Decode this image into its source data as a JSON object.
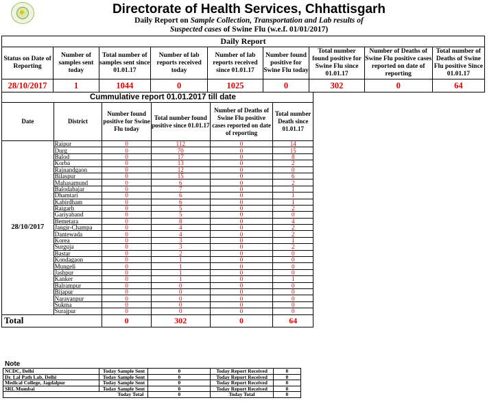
{
  "header": {
    "title": "Directorate of Health Services, Chhattisgarh",
    "line2_prefix": "Daily Report on ",
    "line2_italic": "Sample Collection, Transportation and Lab results of",
    "line3_italic": "Suspected cases",
    "line3_suffix": " of Swine Flu (w.e.f.  01/01/2017)"
  },
  "daily_report": {
    "caption": "Daily Report",
    "columns": [
      "Status on Date of Reporting",
      "Number of samples sent today",
      "Total number of samples sent since 01.01.17",
      "Number of lab reports received today",
      "Number of lab reports received since 01.01.17",
      "Number found positive for Swine Flu today",
      "Total number found positive for Swine Flu since 01.01.17",
      "Number of Deaths of Swine Flu positive cases reported on date of reporting",
      "Total number of Deaths of Swine Flu positive Since 01.01.17"
    ],
    "values": [
      "28/10/2017",
      "1",
      "1044",
      "0",
      "1025",
      "0",
      "302",
      "0",
      "64"
    ]
  },
  "cumulative": {
    "caption": "Cummulative report 01.01.2017 till date",
    "columns": [
      "Date",
      "District",
      "Number found positive for Swine Flu today",
      "Total number found positive since 01.01.17",
      "Number of Deaths of Swine Flu positive cases reported on date of reporting",
      "Total number Death since 01.01.17"
    ],
    "date": "28/10/2017",
    "rows": [
      {
        "district": "Raipur",
        "today": "0",
        "total": "112",
        "deaths_today": "0",
        "deaths_total": "14"
      },
      {
        "district": "Durg",
        "today": "0",
        "total": "70",
        "deaths_today": "0",
        "deaths_total": "15"
      },
      {
        "district": "Balod",
        "today": "0",
        "total": "17",
        "deaths_today": "0",
        "deaths_total": "8"
      },
      {
        "district": "Korba",
        "today": "0",
        "total": "13",
        "deaths_today": "0",
        "deaths_total": "2"
      },
      {
        "district": "Rajnandgaon",
        "today": "0",
        "total": "12",
        "deaths_today": "0",
        "deaths_total": "0"
      },
      {
        "district": "Bilaspur",
        "today": "0",
        "total": "15",
        "deaths_today": "0",
        "deaths_total": "6"
      },
      {
        "district": "Mahasamund",
        "today": "0",
        "total": "6",
        "deaths_today": "0",
        "deaths_total": "2"
      },
      {
        "district": "Balodabajar",
        "today": "0",
        "total": "7",
        "deaths_today": "0",
        "deaths_total": "1"
      },
      {
        "district": "Dhamtari",
        "today": "0",
        "total": "6",
        "deaths_today": "0",
        "deaths_total": "1"
      },
      {
        "district": "Kabirdham",
        "today": "0",
        "total": "6",
        "deaths_today": "0",
        "deaths_total": "1"
      },
      {
        "district": "Raigarh",
        "today": "0",
        "total": "5",
        "deaths_today": "0",
        "deaths_total": "2"
      },
      {
        "district": "Gariyaband",
        "today": "0",
        "total": "5",
        "deaths_today": "0",
        "deaths_total": "0"
      },
      {
        "district": "Bemetara",
        "today": "0",
        "total": "8",
        "deaths_today": "0",
        "deaths_total": "4"
      },
      {
        "district": "Jangir-Champa",
        "today": "0",
        "total": "4",
        "deaths_today": "0",
        "deaths_total": "2"
      },
      {
        "district": "Dantewada",
        "today": "0",
        "total": "4",
        "deaths_today": "0",
        "deaths_total": "2"
      },
      {
        "district": "Korea",
        "today": "0",
        "total": "3",
        "deaths_today": "0",
        "deaths_total": "1"
      },
      {
        "district": "Surguja",
        "today": "0",
        "total": "3",
        "deaths_today": "0",
        "deaths_total": "2"
      },
      {
        "district": "Bastar",
        "today": "0",
        "total": "2",
        "deaths_today": "0",
        "deaths_total": "0"
      },
      {
        "district": "Kondagaon",
        "today": "0",
        "total": "1",
        "deaths_today": "0",
        "deaths_total": "0"
      },
      {
        "district": "Mungeli",
        "today": "0",
        "total": "1",
        "deaths_today": "0",
        "deaths_total": "0"
      },
      {
        "district": "Jashpur",
        "today": "0",
        "total": "1",
        "deaths_today": "0",
        "deaths_total": "0"
      },
      {
        "district": "Kanker",
        "today": "0",
        "total": "1",
        "deaths_today": "0",
        "deaths_total": "1"
      },
      {
        "district": "Balrampur",
        "today": "0",
        "total": "0",
        "deaths_today": "0",
        "deaths_total": "0"
      },
      {
        "district": "Bijapur",
        "today": "0",
        "total": "0",
        "deaths_today": "0",
        "deaths_total": "0"
      },
      {
        "district": "Narayanpur",
        "today": "0",
        "total": "0",
        "deaths_today": "0",
        "deaths_total": "0"
      },
      {
        "district": "Sukma",
        "today": "0",
        "total": "0",
        "deaths_today": "0",
        "deaths_total": "0"
      },
      {
        "district": "Surajpur",
        "today": "0",
        "total": "0",
        "deaths_today": "0",
        "deaths_total": "0"
      }
    ],
    "total_label": "Total",
    "totals": {
      "today": "0",
      "total": "302",
      "deaths_today": "0",
      "deaths_total": "64"
    }
  },
  "note": {
    "label": "Note",
    "rows": [
      {
        "lab": "NCDC, Delhi",
        "sent_label": "Today Sample Sent",
        "sent": "0",
        "recv_label": "Today Report Received",
        "recv": "0"
      },
      {
        "lab": "Dr. Lal Path Lab, Delhi",
        "sent_label": "Today Sample Sent",
        "sent": "0",
        "recv_label": "Today Report Received",
        "recv": "0"
      },
      {
        "lab": "Medical College, Jagdalpur",
        "sent_label": "Today Sample Sent",
        "sent": "0",
        "recv_label": "Today Report Received",
        "recv": "0"
      },
      {
        "lab": "SRL Mumbai",
        "sent_label": "Today Sample Sent",
        "sent": "0",
        "recv_label": "Today Report Received",
        "recv": "0"
      }
    ],
    "total_row": {
      "sent_label": "Today Total",
      "sent": "0",
      "recv_label": "Today Total",
      "recv": "0"
    }
  },
  "colors": {
    "value_red": "#e00000"
  }
}
